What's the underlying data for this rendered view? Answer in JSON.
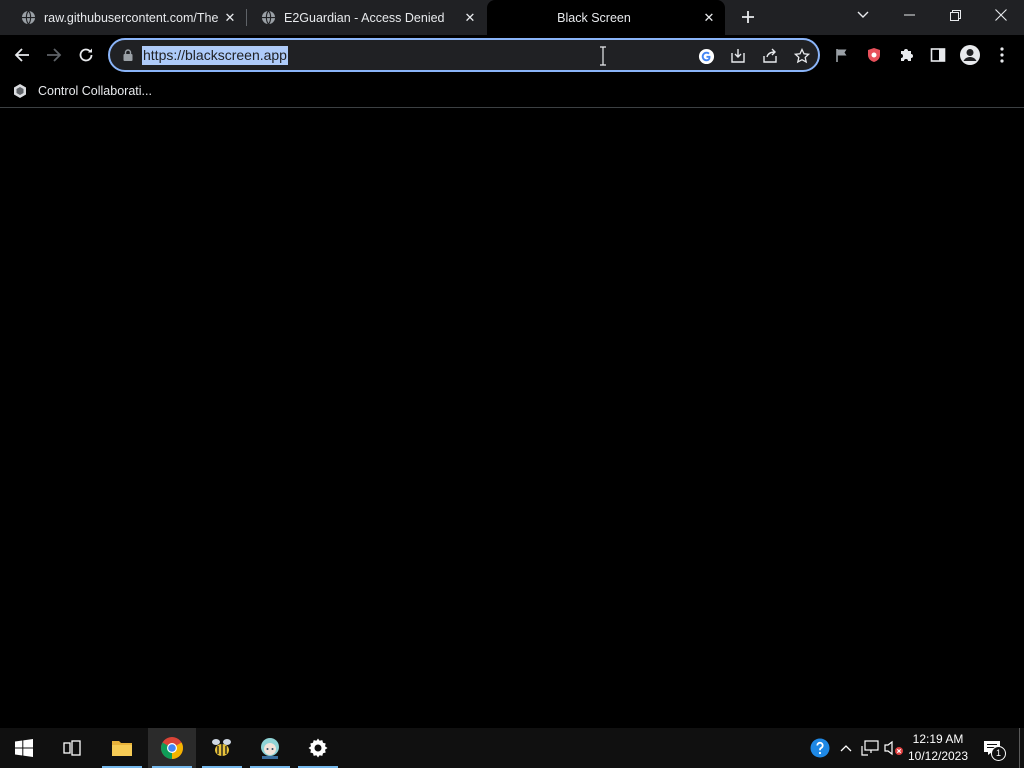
{
  "browser": {
    "tabs": [
      {
        "title": "raw.githubusercontent.com/The",
        "favicon": "globe-icon",
        "active": false
      },
      {
        "title": "E2Guardian - Access Denied",
        "favicon": "globe-icon",
        "active": false
      },
      {
        "title": "Black Screen",
        "favicon": "none",
        "active": true
      }
    ],
    "address_bar": {
      "url": "https://blackscreen.app",
      "selected": true
    },
    "bookmarks": [
      {
        "label": "Control Collaborati...",
        "icon": "control-collaboration-icon"
      }
    ],
    "colors": {
      "tabstrip": "#202124",
      "active_tab": "#000000",
      "omnibox_focus": "#8ab4f8",
      "selection": "#aecbfa"
    }
  },
  "taskbar": {
    "pinned": [
      {
        "name": "start-button",
        "icon": "windows-logo-icon"
      },
      {
        "name": "task-view-button",
        "icon": "task-view-icon"
      },
      {
        "name": "file-explorer-button",
        "icon": "folder-icon"
      },
      {
        "name": "chrome-button",
        "icon": "chrome-icon",
        "active": true
      },
      {
        "name": "app-bee-button",
        "icon": "bee-app-icon"
      },
      {
        "name": "app-anime-button",
        "icon": "anime-app-icon"
      },
      {
        "name": "settings-button",
        "icon": "gear-icon"
      }
    ],
    "clock": {
      "time": "12:19 AM",
      "date": "10/12/2023"
    },
    "notification_count": "1"
  }
}
